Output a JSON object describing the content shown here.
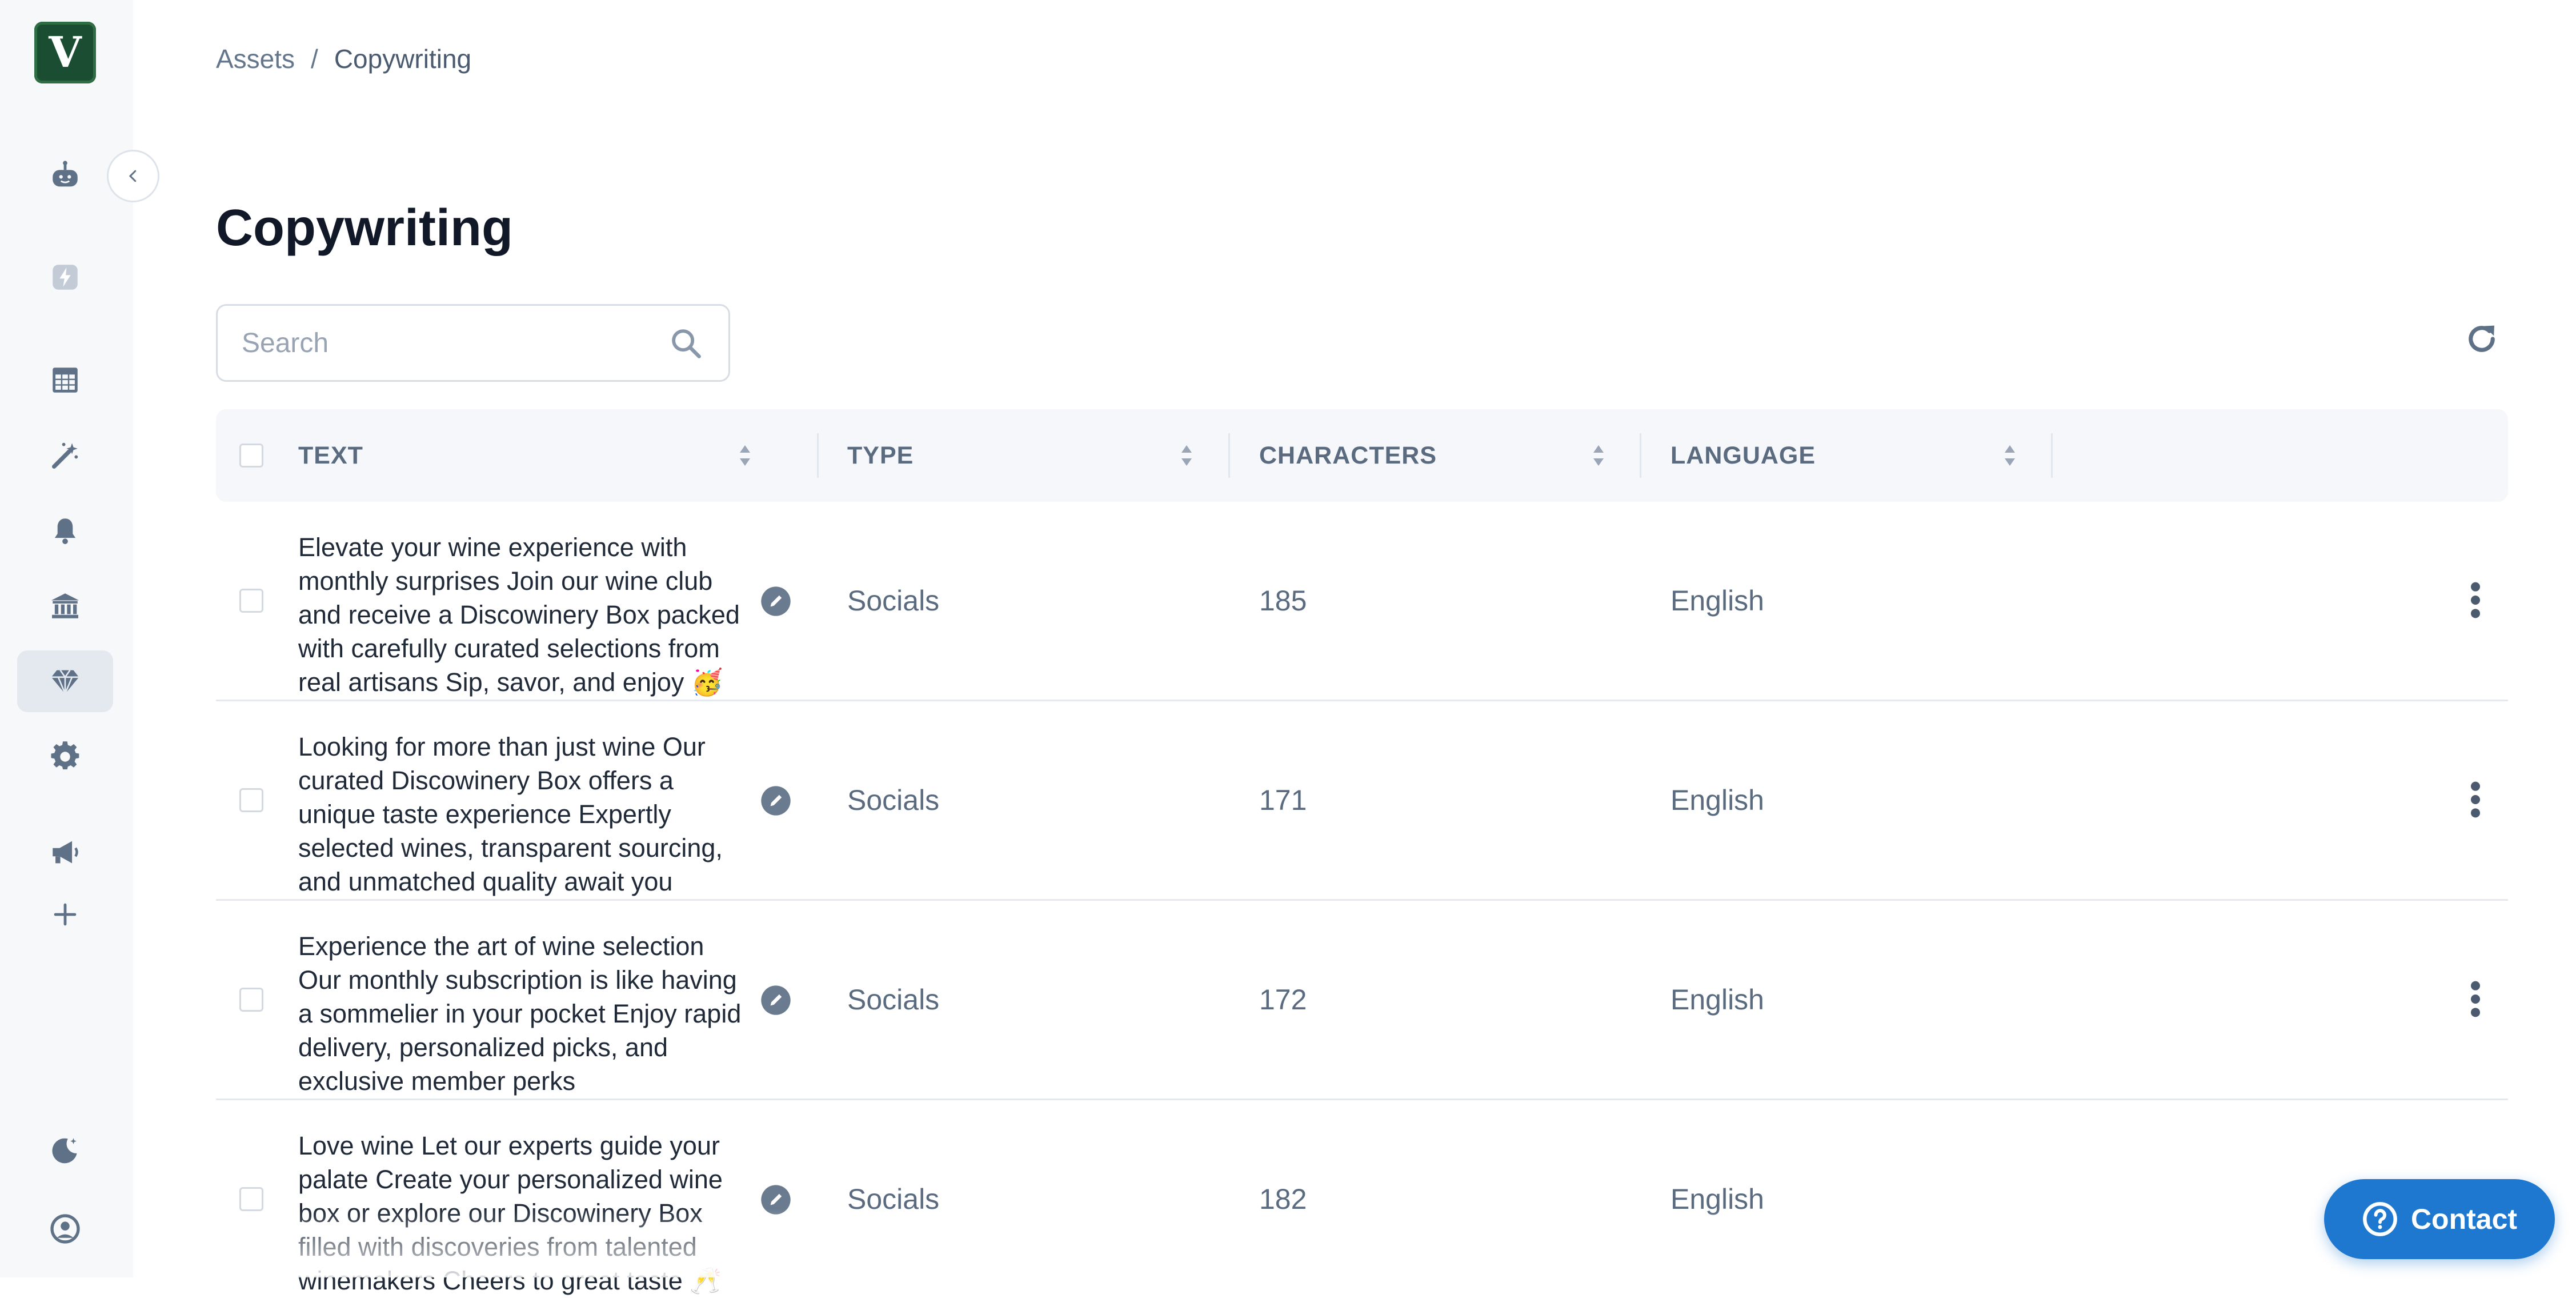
{
  "app": {
    "logo_letter": "V",
    "brand_color": "#1a4d31"
  },
  "sidebar": {
    "items": [
      {
        "icon": "robot-icon",
        "active": false
      },
      {
        "icon": "lightning-icon",
        "active": false
      },
      {
        "icon": "table-icon",
        "active": false
      },
      {
        "icon": "magic-wand-icon",
        "active": false
      },
      {
        "icon": "bell-icon",
        "active": false
      },
      {
        "icon": "bank-icon",
        "active": false
      },
      {
        "icon": "diamond-icon",
        "active": true
      },
      {
        "icon": "gear-icon",
        "active": false
      },
      {
        "icon": "megaphone-icon",
        "active": false
      },
      {
        "icon": "plus-icon",
        "active": false
      }
    ],
    "bottom_items": [
      {
        "icon": "moon-icon"
      },
      {
        "icon": "user-circle-icon"
      }
    ],
    "collapse_icon": "chevron-left-icon"
  },
  "breadcrumb": {
    "root": "Assets",
    "separator": "/",
    "current": "Copywriting"
  },
  "page": {
    "title": "Copywriting"
  },
  "search": {
    "placeholder": "Search",
    "value": ""
  },
  "table": {
    "columns": [
      "TEXT",
      "TYPE",
      "CHARACTERS",
      "LANGUAGE"
    ],
    "rows": [
      {
        "text": "Elevate your wine experience with monthly surprises Join our wine club and receive a Discowinery Box packed with carefully curated selections from real artisans Sip, savor, and enjoy 🥳",
        "type": "Socials",
        "characters": "185",
        "language": "English"
      },
      {
        "text": "Looking for more than just wine Our curated Discowinery Box offers a unique taste experience Expertly selected wines, transparent sourcing, and unmatched quality await you",
        "type": "Socials",
        "characters": "171",
        "language": "English"
      },
      {
        "text": "Experience the art of wine selection Our monthly subscription is like having a sommelier in your pocket Enjoy rapid delivery, personalized picks, and exclusive member perks",
        "type": "Socials",
        "characters": "172",
        "language": "English"
      },
      {
        "text": "Love wine Let our experts guide your palate Create your personalized wine box or explore our Discowinery Box filled with discoveries from talented winemakers Cheers to great taste 🥂",
        "type": "Socials",
        "characters": "182",
        "language": "English"
      }
    ]
  },
  "contact": {
    "label": "Contact",
    "color": "#1e78cf"
  }
}
